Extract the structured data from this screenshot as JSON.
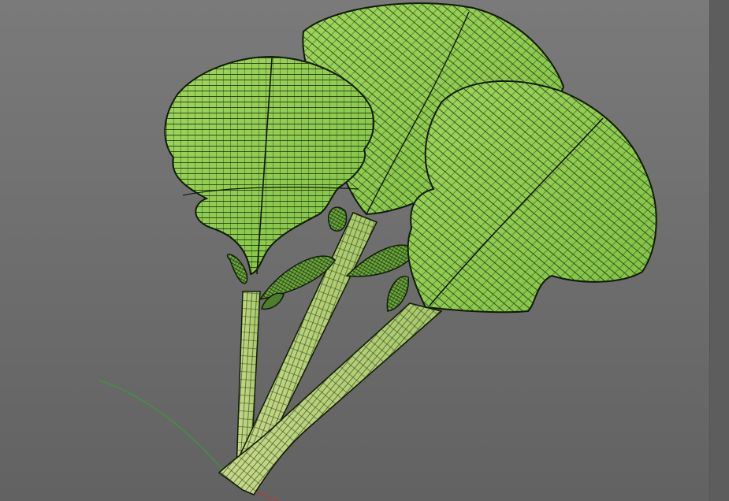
{
  "viewport": {
    "background_top": "#7a7a7a",
    "background_bottom": "#626262",
    "side_strip": "#5d5d5d"
  },
  "model": {
    "leaf_fill": "#8fcf4f",
    "leaf_fill_light": "#a9dc6a",
    "stem_fill": "#b9d37a",
    "wire_color": "#1c2a10",
    "outline_color": "#0f1a08"
  },
  "axes": {
    "y_axis_color": "#3a9a3a",
    "x_axis_color": "#c83232"
  }
}
